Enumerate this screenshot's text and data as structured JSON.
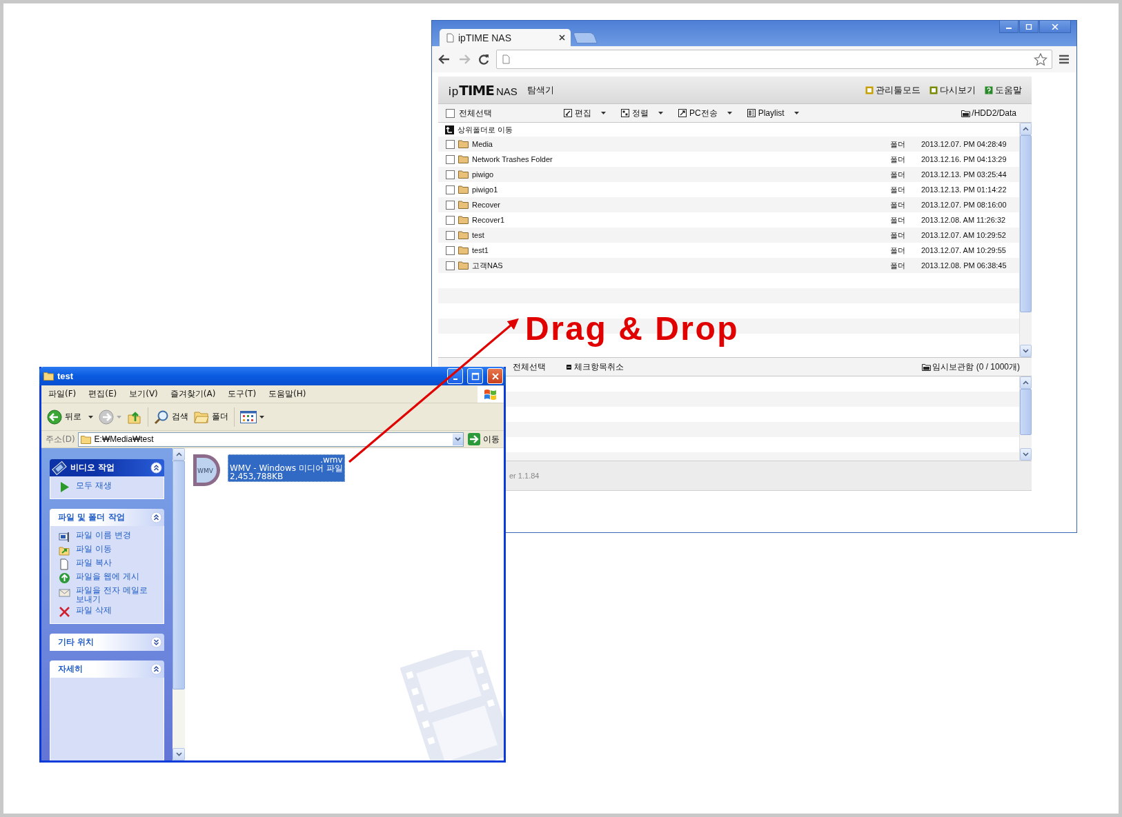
{
  "browser": {
    "tab": {
      "title": "ipTIME NAS"
    },
    "nas": {
      "logo": {
        "prefix": "ip",
        "brand": "TIME",
        "suffix": "NAS"
      },
      "title": "탐색기",
      "header_links": [
        {
          "label": "관리툴모드",
          "kind": "admin"
        },
        {
          "label": "다시보기",
          "kind": "refresh"
        },
        {
          "label": "도움말",
          "kind": "help"
        }
      ],
      "toolbar": {
        "select_all": {
          "label": "전체선택",
          "checked": false
        },
        "menus": [
          {
            "label": "편집",
            "kind": "edit"
          },
          {
            "label": "정렬",
            "kind": "sort"
          },
          {
            "label": "PC전송",
            "kind": "transfer"
          },
          {
            "label": "Playlist",
            "kind": "playlist"
          }
        ],
        "path": "/HDD2/Data"
      },
      "up_folder": "상위폴더로 이동",
      "files": [
        {
          "name": "Media",
          "type": "폴더",
          "date": "2013.12.07. PM 04:28:49",
          "checked": false
        },
        {
          "name": "Network Trashes Folder",
          "type": "폴더",
          "date": "2013.12.16. PM 04:13:29",
          "checked": false
        },
        {
          "name": "piwigo",
          "type": "폴더",
          "date": "2013.12.13. PM 03:25:44",
          "checked": false
        },
        {
          "name": "piwigo1",
          "type": "폴더",
          "date": "2013.12.13. PM 01:14:22",
          "checked": false
        },
        {
          "name": "Recover",
          "type": "폴더",
          "date": "2013.12.07. PM 08:16:00",
          "checked": false
        },
        {
          "name": "Recover1",
          "type": "폴더",
          "date": "2013.12.08. AM 11:26:32",
          "checked": false
        },
        {
          "name": "test",
          "type": "폴더",
          "date": "2013.12.07. AM 10:29:52",
          "checked": false
        },
        {
          "name": "test1",
          "type": "폴더",
          "date": "2013.12.07. AM 10:29:55",
          "checked": false
        },
        {
          "name": "고객NAS",
          "type": "폴더",
          "date": "2013.12.08. PM 06:38:45",
          "checked": false
        }
      ],
      "bottom_bar": {
        "select_all": "전체선택",
        "uncheck": "체크항목취소",
        "storage": "임시보관함 (0 / 1000개)"
      },
      "version": "er 1.1.84"
    }
  },
  "annotation": {
    "text": "Drag & Drop"
  },
  "explorer": {
    "title": "test",
    "menus": [
      "파일(F)",
      "편집(E)",
      "보기(V)",
      "즐겨찾기(A)",
      "도구(T)",
      "도움말(H)"
    ],
    "toolbar": {
      "back": "뒤로",
      "search": "검색",
      "folders": "폴더"
    },
    "address": {
      "label": "주소(D)",
      "value": "E:₩Media₩test",
      "go": "이동"
    },
    "task_sections": [
      {
        "title": "비디오 작업",
        "kind": "special",
        "expanded": true,
        "items": [
          {
            "label": "모두 재생",
            "kind": "play"
          }
        ]
      },
      {
        "title": "파일 및 폴더 작업",
        "kind": "normal",
        "expanded": true,
        "items": [
          {
            "label": "파일 이름 변경",
            "kind": "rename"
          },
          {
            "label": "파일 이동",
            "kind": "move"
          },
          {
            "label": "파일 복사",
            "kind": "copy"
          },
          {
            "label": "파일을 웹에 게시",
            "kind": "publish"
          },
          {
            "label": "파일을 전자 메일로 보내기",
            "kind": "email"
          },
          {
            "label": "파일 삭제",
            "kind": "delete"
          }
        ]
      },
      {
        "title": "기타 위치",
        "kind": "normal",
        "expanded": false
      },
      {
        "title": "자세히",
        "kind": "normal",
        "expanded": true
      }
    ],
    "file": {
      "icon_label": "WMV",
      "ext": ".wmv",
      "type": "WMV - Windows 미디어 파일",
      "size": "2,453,788KB",
      "selected": true
    }
  }
}
